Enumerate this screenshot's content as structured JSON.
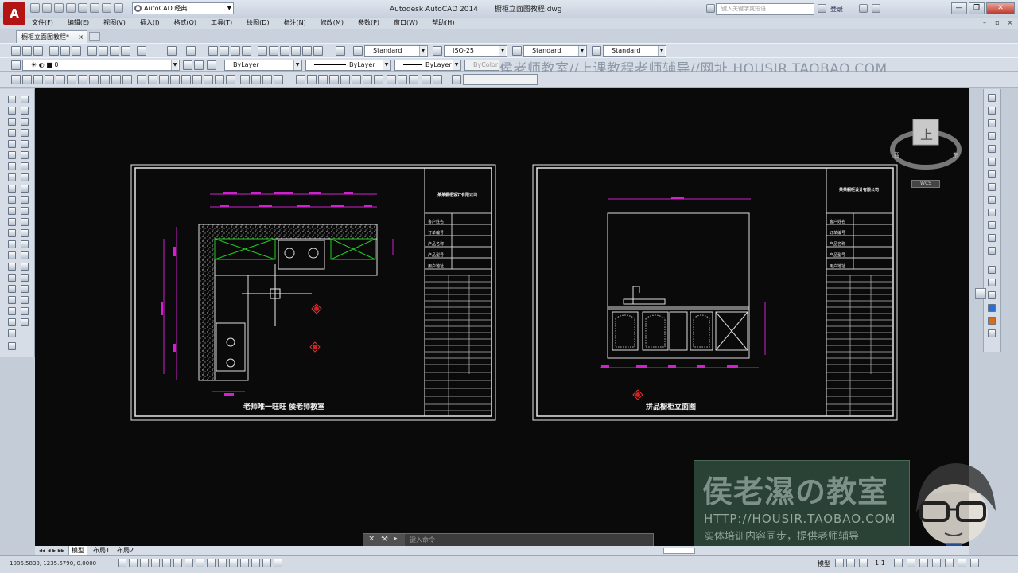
{
  "app": {
    "logo": "A",
    "workspace": "AutoCAD 经典",
    "app_title": "Autodesk AutoCAD 2014",
    "file_title": "橱柜立面图教程.dwg",
    "search_placeholder": "键入关键字或短语",
    "login": "登录",
    "window_controls": [
      "—",
      "❐",
      "✕"
    ]
  },
  "menu": [
    "文件(F)",
    "编辑(E)",
    "视图(V)",
    "插入(I)",
    "格式(O)",
    "工具(T)",
    "绘图(D)",
    "标注(N)",
    "修改(M)",
    "参数(P)",
    "窗口(W)",
    "帮助(H)"
  ],
  "file_tab": {
    "label": "橱柜立面图教程*",
    "close": "×"
  },
  "styles_toolbar": {
    "text_style": "Standard",
    "dim_style": "ISO-25",
    "table_style": "Standard",
    "mleader_style": "Standard"
  },
  "layers_toolbar": {
    "layer": "0",
    "color": "ByLayer",
    "linetype": "ByLayer",
    "lineweight": "ByLayer",
    "plotstyle": "ByColor"
  },
  "watermarks": {
    "toolbar": "侯老师教室//上课教程老师辅导//网址 HOUSIR.TAOBAO.COM",
    "promo_title": "侯老濕の教室",
    "promo_url": "HTTP://HOUSIR.TAOBAO.COM",
    "promo_tagline": "实体培训内容同步，提供老师辅导"
  },
  "drawings": {
    "left": {
      "caption": "老师唯一旺旺 侯老师教室",
      "header": "某某橱柜设计有限公司",
      "rows": [
        "客户姓名",
        "订单编号",
        "产品名称",
        "产品型号",
        "用户地址"
      ]
    },
    "right": {
      "caption": "拼品橱柜立面图",
      "header": "某某橱柜设计有限公司",
      "rows": [
        "客户姓名",
        "订单编号",
        "产品名称",
        "产品型号",
        "用户地址"
      ]
    }
  },
  "viewcube": {
    "face": "上",
    "n": "北",
    "e": "东",
    "w": "西",
    "s": "南",
    "wcs": "WCS"
  },
  "layout_tabs": [
    "模型",
    "布局1",
    "布局2"
  ],
  "command": {
    "placeholder": "键入命令"
  },
  "status": {
    "coords": "1086.5830, 1235.6790, 0.0000",
    "model": "模型",
    "scale": "1:1"
  }
}
